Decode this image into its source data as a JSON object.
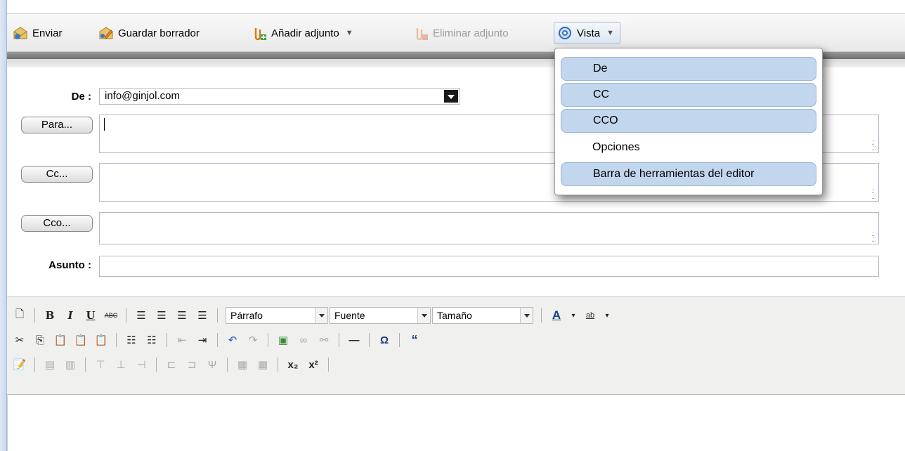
{
  "toolbar": {
    "send_label": "Enviar",
    "save_draft_label": "Guardar borrador",
    "add_attachment_label": "Añadir adjunto",
    "remove_attachment_label": "Eliminar adjunto",
    "view_label": "Vista"
  },
  "view_menu": {
    "items": [
      {
        "label": "De",
        "checked": true
      },
      {
        "label": "CC",
        "checked": true
      },
      {
        "label": "CCO",
        "checked": true
      },
      {
        "label": "Opciones",
        "checked": false
      },
      {
        "label": "Barra de herramientas del editor",
        "checked": true
      }
    ]
  },
  "form": {
    "from_label": "De :",
    "from_value": "info@ginjol.com",
    "to_button": "Para...",
    "cc_button": "Cc...",
    "bcc_button": "Cco...",
    "subject_label": "Asunto :",
    "subject_value": ""
  },
  "editor": {
    "format_select": "Párrafo",
    "font_select": "Fuente",
    "size_select": "Tamaño"
  },
  "colors": {
    "menu_checked": "#c2d6ee",
    "accent_border": "#99bbe8"
  }
}
